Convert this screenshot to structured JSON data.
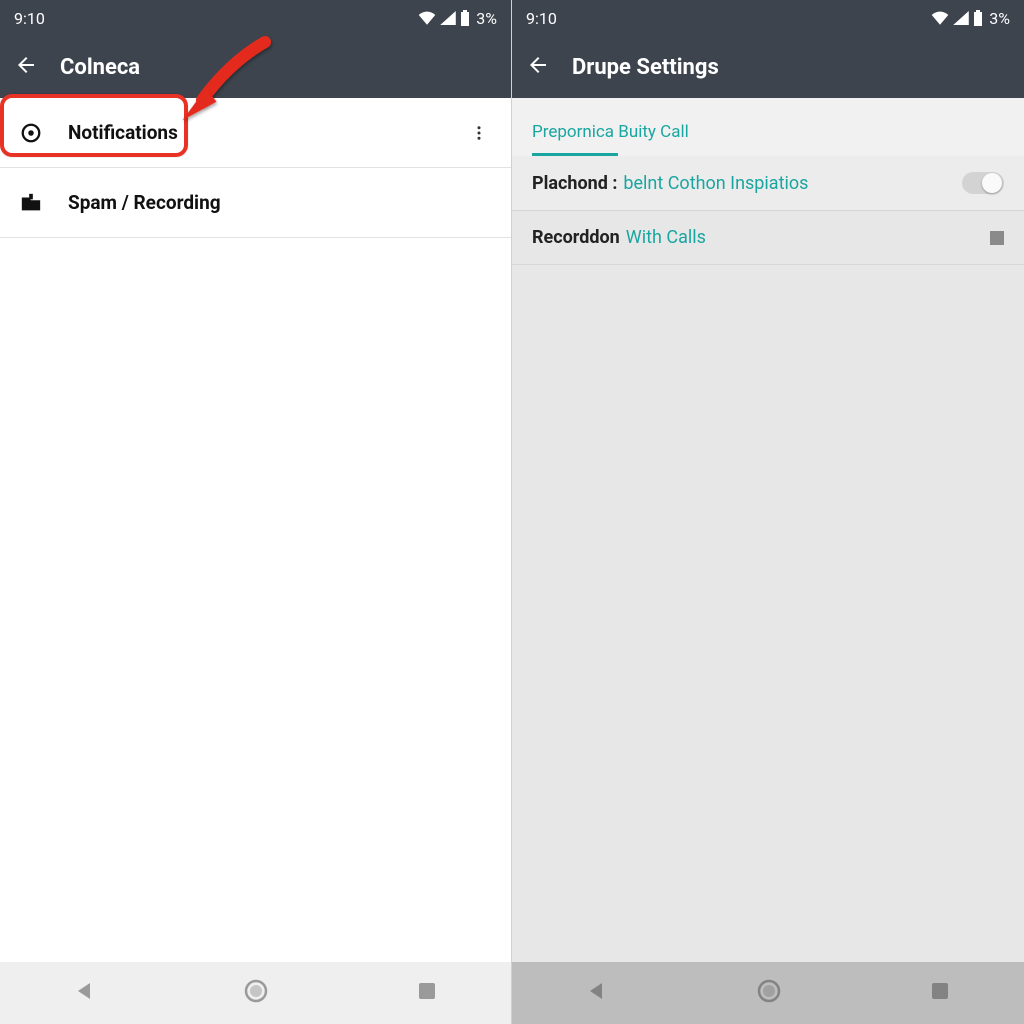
{
  "left": {
    "status": {
      "time": "9:10",
      "battery": "3%"
    },
    "appbar": {
      "title": "Colneca"
    },
    "rows": [
      {
        "label": "Notifications"
      },
      {
        "label": "Spam / Recording"
      }
    ]
  },
  "right": {
    "status": {
      "time": "9:10",
      "battery": "3%"
    },
    "appbar": {
      "title": "Drupe Settings"
    },
    "tab": {
      "label": "Prepornica Buity Call"
    },
    "settings": [
      {
        "label": "Plachond :",
        "value": "belnt Cothon Inspiatios"
      },
      {
        "label": "Recorddon",
        "value": "With Calls"
      }
    ]
  },
  "colors": {
    "header": "#3d444d",
    "accent": "#1aa6a0",
    "highlight": "#e93226"
  }
}
